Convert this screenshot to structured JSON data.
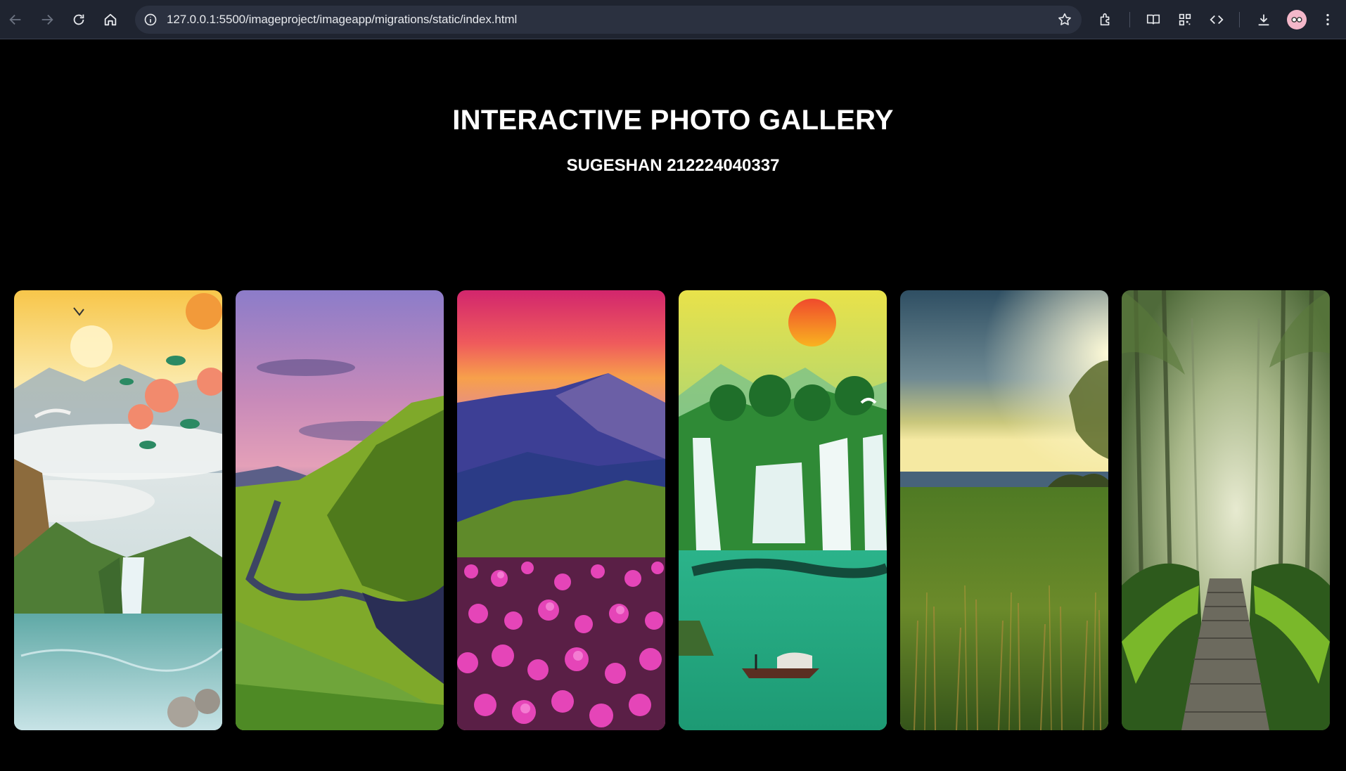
{
  "browser": {
    "url": "127.0.0.1:5500/imageproject/imageapp/migrations/static/index.html",
    "nav_icons": [
      "back-icon",
      "forward-icon",
      "reload-icon",
      "home-icon"
    ],
    "toolbar_icons": [
      "site-info-icon",
      "bookmark-star-icon",
      "extensions-icon",
      "reading-mode-icon",
      "qr-code-icon",
      "devtools-icon",
      "download-icon",
      "profile-avatar",
      "more-menu-icon"
    ]
  },
  "page": {
    "title": "INTERACTIVE PHOTO GALLERY",
    "subtitle": "SUGESHAN 212224040337"
  },
  "gallery": {
    "images": [
      {
        "name": "waterfall-blossom-painting"
      },
      {
        "name": "green-valley-river"
      },
      {
        "name": "mountain-flowers-sunset"
      },
      {
        "name": "waterfalls-sun-boat"
      },
      {
        "name": "grassland-sea-sunset"
      },
      {
        "name": "misty-forest-path"
      }
    ]
  },
  "colors": {
    "page_background": "#000000",
    "toolbar_background": "#1f2430",
    "omnibox_background": "#2b3140",
    "text": "#ffffff"
  }
}
